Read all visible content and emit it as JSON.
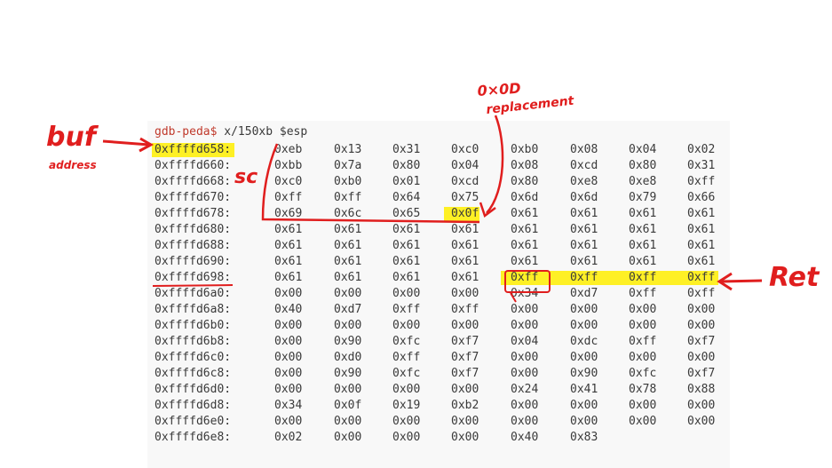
{
  "terminal": {
    "prompt": "gdb-peda$",
    "command": " x/150xb $esp",
    "rows": [
      {
        "addr": "0xffffd658:",
        "bytes": [
          "0xeb",
          "0x13",
          "0x31",
          "0xc0",
          "0xb0",
          "0x08",
          "0x04",
          "0x02"
        ]
      },
      {
        "addr": "0xffffd660:",
        "bytes": [
          "0xbb",
          "0x7a",
          "0x80",
          "0x04",
          "0x08",
          "0xcd",
          "0x80",
          "0x31"
        ]
      },
      {
        "addr": "0xffffd668:",
        "bytes": [
          "0xc0",
          "0xb0",
          "0x01",
          "0xcd",
          "0x80",
          "0xe8",
          "0xe8",
          "0xff"
        ]
      },
      {
        "addr": "0xffffd670:",
        "bytes": [
          "0xff",
          "0xff",
          "0x64",
          "0x75",
          "0x6d",
          "0x6d",
          "0x79",
          "0x66"
        ]
      },
      {
        "addr": "0xffffd678:",
        "bytes": [
          "0x69",
          "0x6c",
          "0x65",
          "0x0f",
          "0x61",
          "0x61",
          "0x61",
          "0x61"
        ]
      },
      {
        "addr": "0xffffd680:",
        "bytes": [
          "0x61",
          "0x61",
          "0x61",
          "0x61",
          "0x61",
          "0x61",
          "0x61",
          "0x61"
        ]
      },
      {
        "addr": "0xffffd688:",
        "bytes": [
          "0x61",
          "0x61",
          "0x61",
          "0x61",
          "0x61",
          "0x61",
          "0x61",
          "0x61"
        ]
      },
      {
        "addr": "0xffffd690:",
        "bytes": [
          "0x61",
          "0x61",
          "0x61",
          "0x61",
          "0x61",
          "0x61",
          "0x61",
          "0x61"
        ]
      },
      {
        "addr": "0xffffd698:",
        "bytes": [
          "0x61",
          "0x61",
          "0x61",
          "0x61",
          "0xff",
          "0xff",
          "0xff",
          "0xff"
        ]
      },
      {
        "addr": "0xffffd6a0:",
        "bytes": [
          "0x00",
          "0x00",
          "0x00",
          "0x00",
          "0x34",
          "0xd7",
          "0xff",
          "0xff"
        ]
      },
      {
        "addr": "0xffffd6a8:",
        "bytes": [
          "0x40",
          "0xd7",
          "0xff",
          "0xff",
          "0x00",
          "0x00",
          "0x00",
          "0x00"
        ]
      },
      {
        "addr": "0xffffd6b0:",
        "bytes": [
          "0x00",
          "0x00",
          "0x00",
          "0x00",
          "0x00",
          "0x00",
          "0x00",
          "0x00"
        ]
      },
      {
        "addr": "0xffffd6b8:",
        "bytes": [
          "0x00",
          "0x90",
          "0xfc",
          "0xf7",
          "0x04",
          "0xdc",
          "0xff",
          "0xf7"
        ]
      },
      {
        "addr": "0xffffd6c0:",
        "bytes": [
          "0x00",
          "0xd0",
          "0xff",
          "0xf7",
          "0x00",
          "0x00",
          "0x00",
          "0x00"
        ]
      },
      {
        "addr": "0xffffd6c8:",
        "bytes": [
          "0x00",
          "0x90",
          "0xfc",
          "0xf7",
          "0x00",
          "0x90",
          "0xfc",
          "0xf7"
        ]
      },
      {
        "addr": "0xffffd6d0:",
        "bytes": [
          "0x00",
          "0x00",
          "0x00",
          "0x00",
          "0x24",
          "0x41",
          "0x78",
          "0x88"
        ]
      },
      {
        "addr": "0xffffd6d8:",
        "bytes": [
          "0x34",
          "0x0f",
          "0x19",
          "0xb2",
          "0x00",
          "0x00",
          "0x00",
          "0x00"
        ]
      },
      {
        "addr": "0xffffd6e0:",
        "bytes": [
          "0x00",
          "0x00",
          "0x00",
          "0x00",
          "0x00",
          "0x00",
          "0x00",
          "0x00"
        ]
      },
      {
        "addr": "0xffffd6e8:",
        "bytes": [
          "0x02",
          "0x00",
          "0x00",
          "0x00",
          "0x40",
          "0x83"
        ]
      }
    ]
  },
  "annotations": {
    "buf": "buf",
    "address": "address",
    "sc": "sc",
    "replacement_top": "0×0D",
    "replacement_bottom": "replacement",
    "ret": "Ret"
  },
  "colors": {
    "prompt": "#c0392b",
    "highlight": "#ffee00",
    "annotation": "#e01e1e"
  }
}
